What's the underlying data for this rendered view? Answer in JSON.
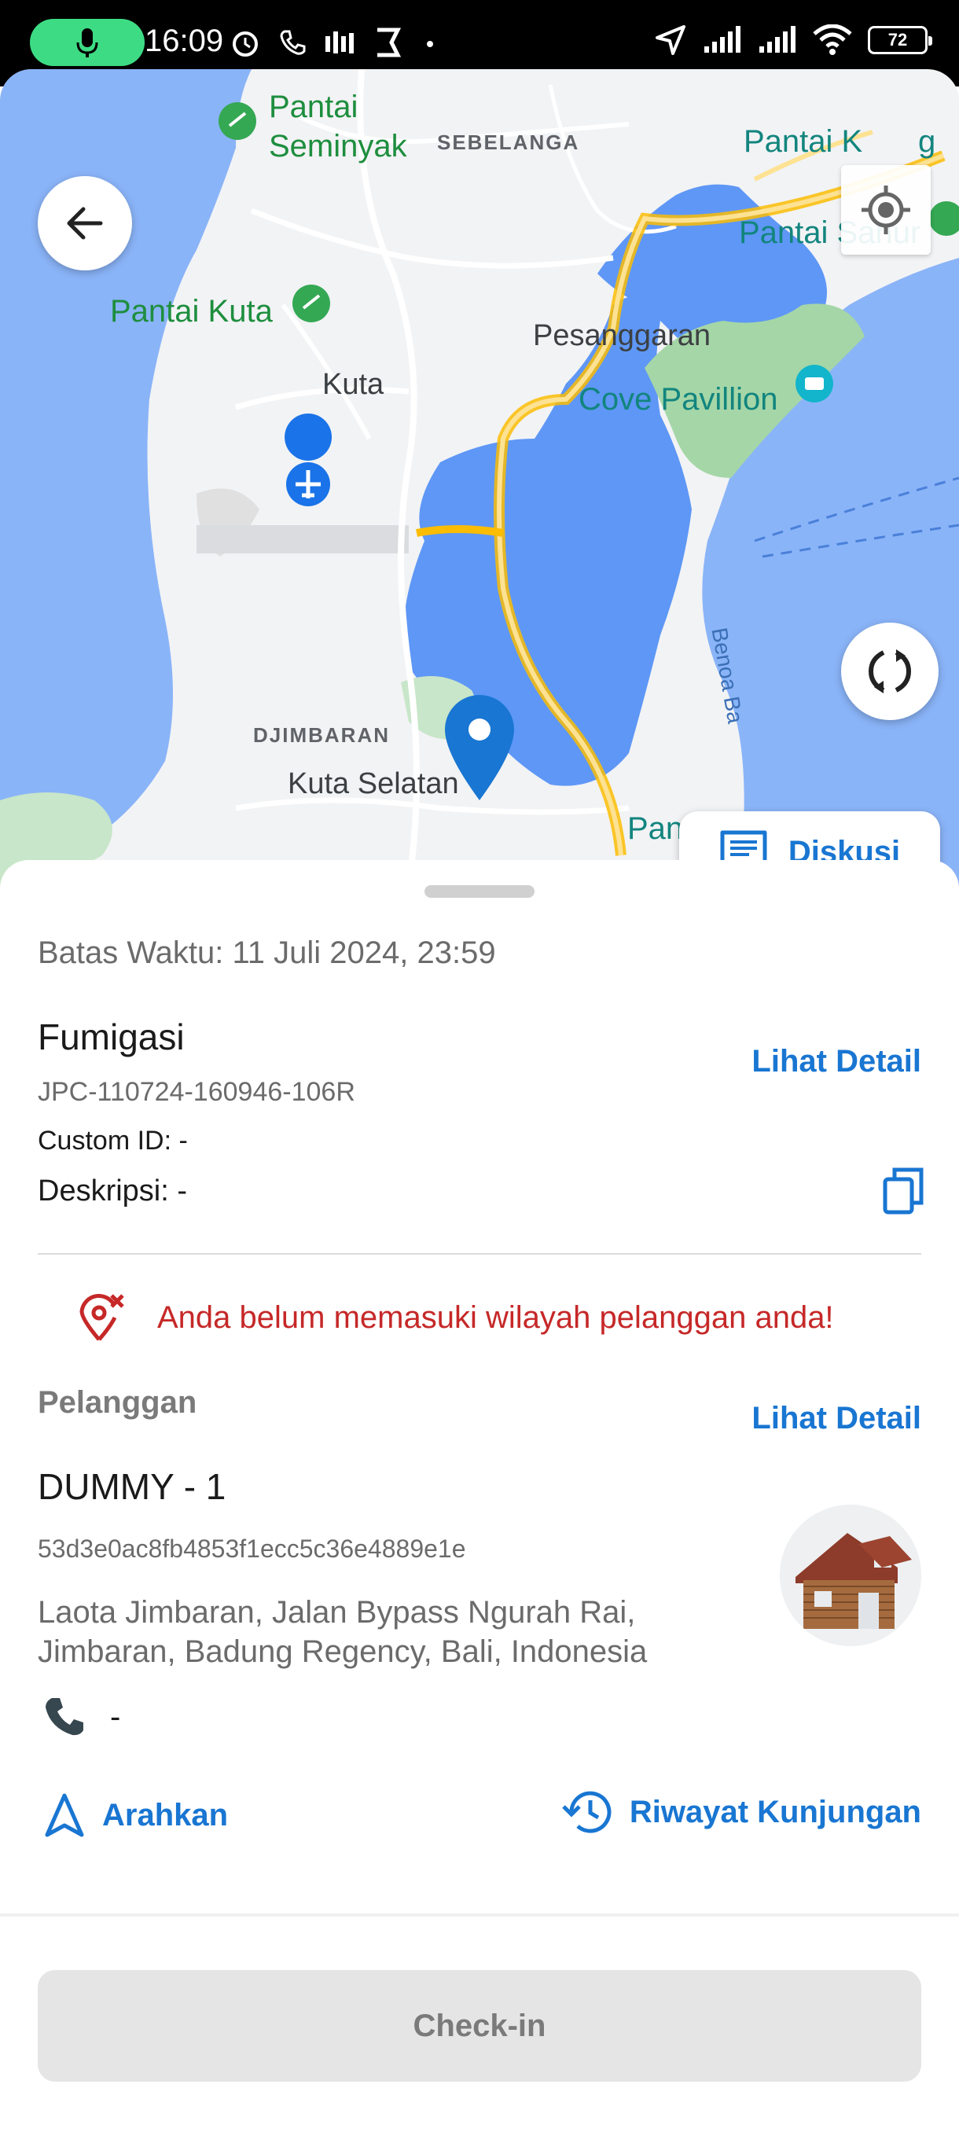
{
  "status_bar": {
    "time": "16:09",
    "battery": "72",
    "icons": [
      "mic-icon",
      "alarm-icon",
      "phone-call-icon",
      "sound-icon",
      "notification-icon",
      "location-arrow-icon",
      "signal-icon",
      "signal-icon",
      "wifi-icon",
      "battery-icon"
    ]
  },
  "map": {
    "labels": {
      "pantai_seminyak_1": "Pantai",
      "pantai_seminyak_2": "Seminyak",
      "sebelanga": "SEBELANGA",
      "pantai_kuta": "Pantai Kuta",
      "kuta": "Kuta",
      "pesanggaran": "Pesanggaran",
      "cove_pavillion": "Cove Pavillion",
      "pantai_sanur": "Pantai Sanur",
      "pantai_k": "Pantai K",
      "pantai_k_tail": "g",
      "djimbaran": "DJIMBARAN",
      "kuta_selatan": "Kuta Selatan",
      "benoa_bay": "Benoa Ba",
      "pantai_bottom": "Pantai"
    },
    "diskusi_label": "Diskusi",
    "colors": {
      "water": "#8ab4f8",
      "deep_water": "#5e97f6",
      "land": "#f1f3f4",
      "park": "#c8e6c9",
      "road_major": "#fdd663",
      "accent": "#1976d2"
    }
  },
  "sheet": {
    "deadline": "Batas Waktu: 11 Juli 2024, 23:59",
    "task_title": "Fumigasi",
    "task_detail_link": "Lihat Detail",
    "task_code": "JPC-110724-160946-106R",
    "custom_id": "Custom ID: -",
    "description": "Deskripsi: -",
    "warning": "Anda belum memasuki wilayah pelanggan anda!",
    "customer_section": "Pelanggan",
    "customer_detail_link": "Lihat Detail",
    "customer_name": "DUMMY - 1",
    "customer_id": "53d3e0ac8fb4853f1ecc5c36e4889e1e",
    "address": "Laota Jimbaran, Jalan Bypass Ngurah Rai, Jimbaran, Badung Regency, Bali, Indonesia",
    "phone": "-",
    "directions_label": "Arahkan",
    "history_label": "Riwayat Kunjungan",
    "checkin_label": "Check-in"
  }
}
